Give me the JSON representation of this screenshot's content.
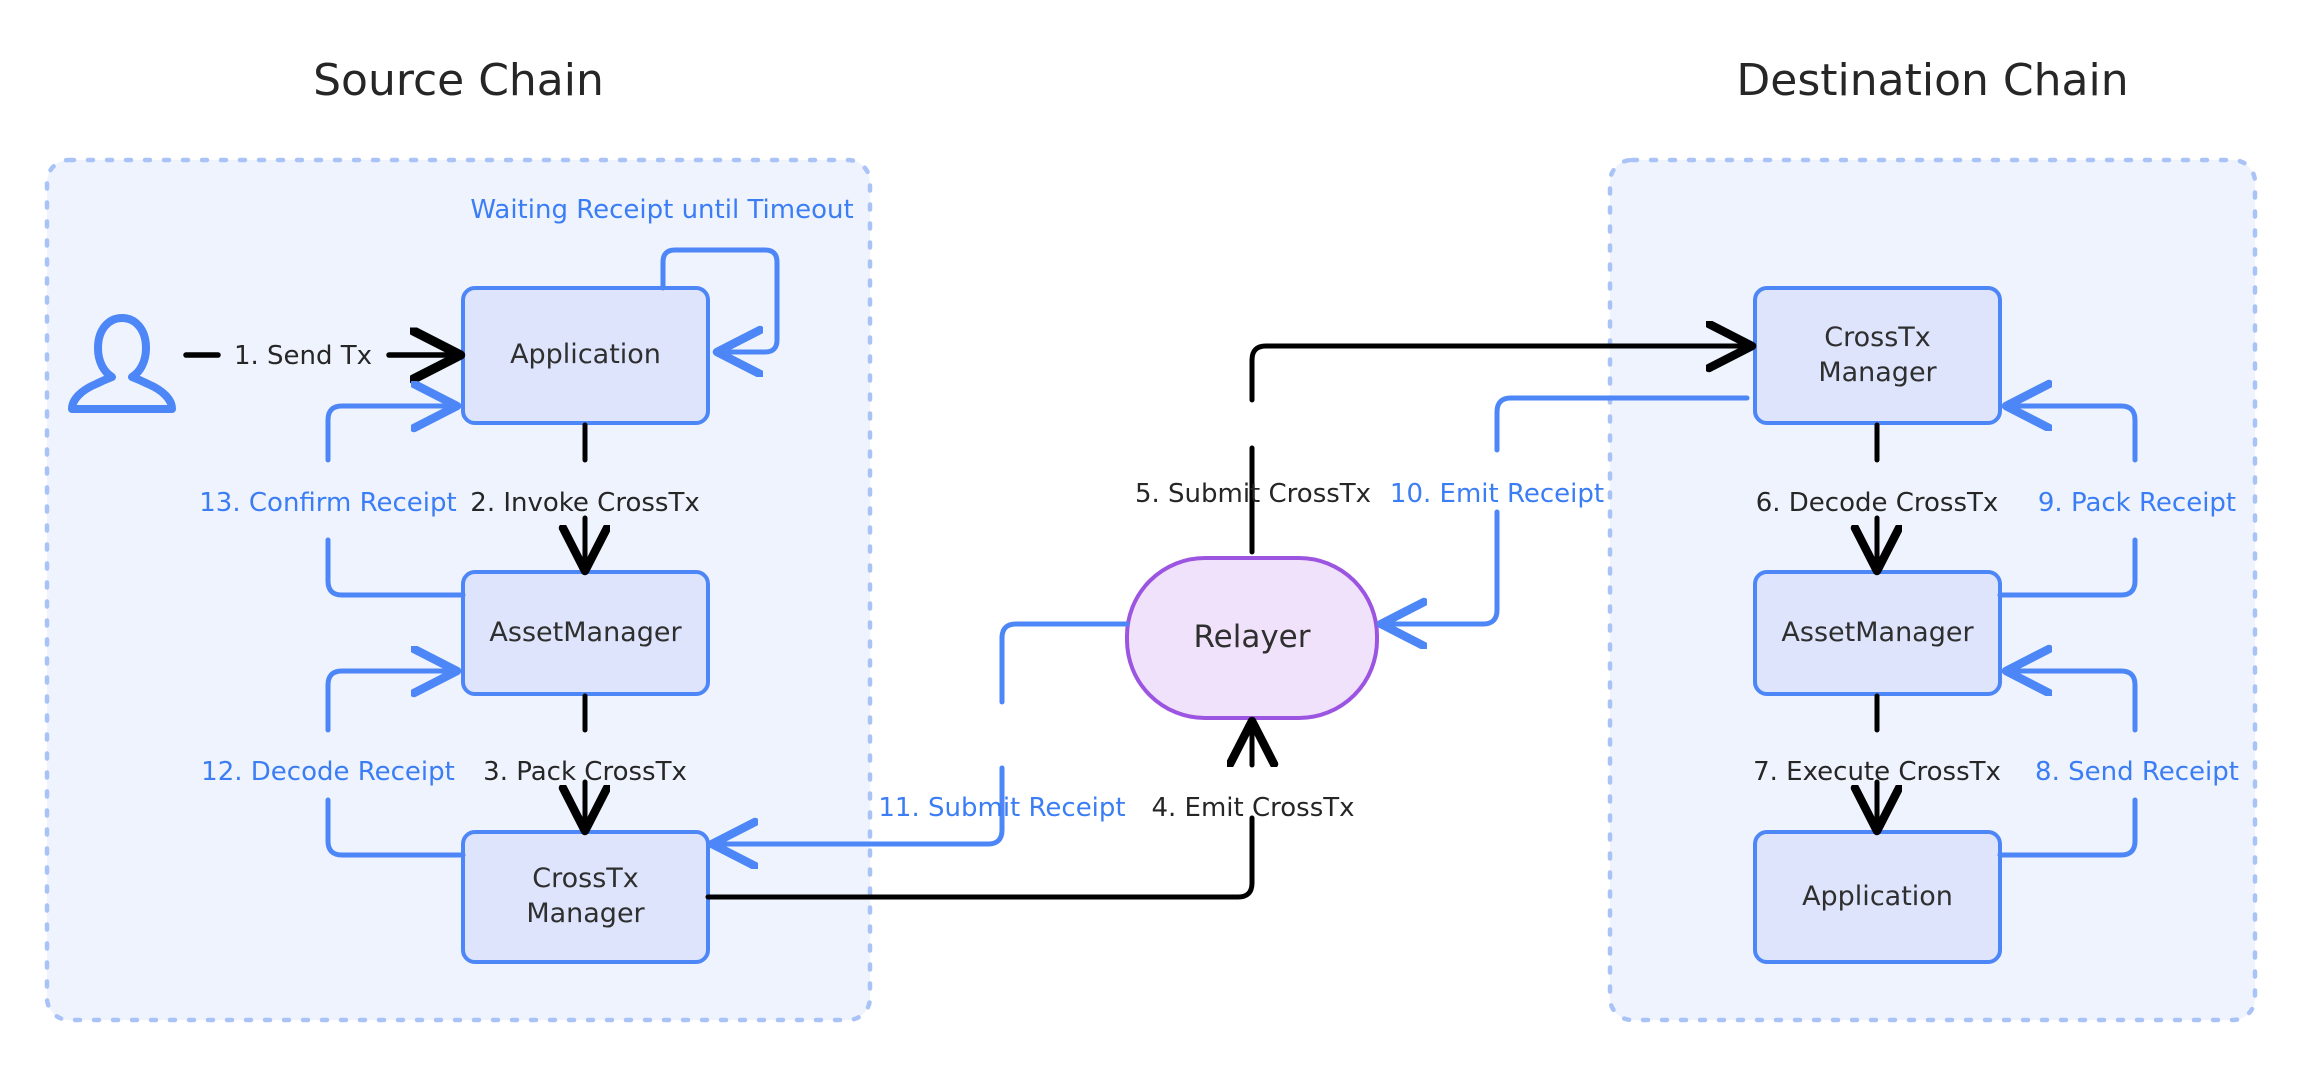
{
  "diagram": {
    "title_source": "Source Chain",
    "title_destination": "Destination Chain",
    "colors": {
      "box_fill": "#dde4fb",
      "box_border": "#4d86f7",
      "chain_fill": "#eef3fd",
      "chain_border": "#a9c3f7",
      "relayer_fill": "#f0e2fb",
      "relayer_border": "#9c55e0",
      "black_edge": "#000000",
      "blue_edge": "#4d86f7",
      "blue_text": "#3b7df4",
      "dark_text": "#262626"
    }
  },
  "source_chain": {
    "note": "Waiting Receipt until Timeout",
    "actor": "user-icon",
    "nodes": {
      "application": "Application",
      "asset_manager": "AssetManager",
      "crosstx_manager_line1": "CrossTx",
      "crosstx_manager_line2": "Manager"
    }
  },
  "destination_chain": {
    "nodes": {
      "crosstx_manager_line1": "CrossTx",
      "crosstx_manager_line2": "Manager",
      "asset_manager": "AssetManager",
      "application": "Application"
    }
  },
  "relayer": {
    "label": "Relayer"
  },
  "steps": [
    {
      "id": 1,
      "label": "1. Send Tx",
      "color": "black"
    },
    {
      "id": 2,
      "label": "2. Invoke CrossTx",
      "color": "black"
    },
    {
      "id": 3,
      "label": "3. Pack CrossTx",
      "color": "black"
    },
    {
      "id": 4,
      "label": "4. Emit CrossTx",
      "color": "black"
    },
    {
      "id": 5,
      "label": "5. Submit CrossTx",
      "color": "black"
    },
    {
      "id": 6,
      "label": "6. Decode CrossTx",
      "color": "black"
    },
    {
      "id": 7,
      "label": "7. Execute CrossTx",
      "color": "black"
    },
    {
      "id": 8,
      "label": "8. Send Receipt",
      "color": "blue"
    },
    {
      "id": 9,
      "label": "9. Pack Receipt",
      "color": "blue"
    },
    {
      "id": 10,
      "label": "10. Emit Receipt",
      "color": "blue"
    },
    {
      "id": 11,
      "label": "11. Submit Receipt",
      "color": "blue"
    },
    {
      "id": 12,
      "label": "12. Decode Receipt",
      "color": "blue"
    },
    {
      "id": 13,
      "label": "13. Confirm Receipt",
      "color": "blue"
    }
  ]
}
